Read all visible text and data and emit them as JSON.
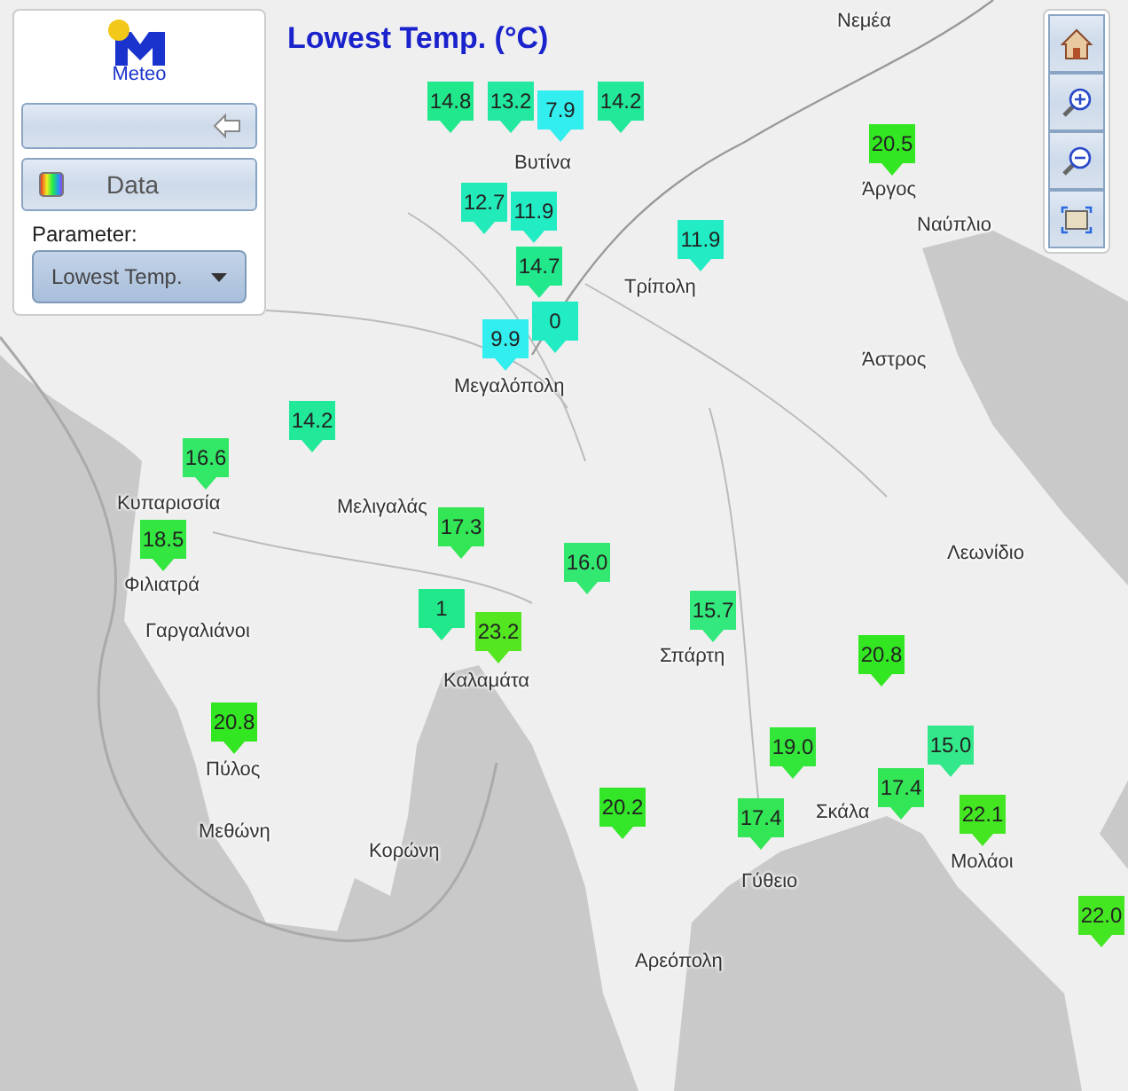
{
  "title": "Lowest Temp. (°C)",
  "panel": {
    "logo_text": "Meteo",
    "data_button": "Data",
    "parameter_label": "Parameter:",
    "parameter_select": "Lowest Temp."
  },
  "places": [
    "Νεμέα",
    "Βυτίνα",
    "Τρίπολη",
    "Άργος",
    "Ναύπλιο",
    "Μεγαλόπολη",
    "Άστρος",
    "Κυπαρισσία",
    "Μελιγαλάς",
    "Φιλιατρά",
    "Λεωνίδιο",
    "Γαργαλιάνοι",
    "Καλαμάτα",
    "Σπάρτη",
    "Πύλος",
    "Σκάλα",
    "Μολάοι",
    "Μεθώνη",
    "Κορώνη",
    "Γύθειο",
    "Αρεόπολη"
  ],
  "markers": [
    {
      "value": "14.8",
      "color": "#22e88c"
    },
    {
      "value": "13.2",
      "color": "#22e8a0"
    },
    {
      "value": "7.9",
      "color": "#33eeee"
    },
    {
      "value": "14.2",
      "color": "#22e89a"
    },
    {
      "value": "12.7",
      "color": "#22eab8"
    },
    {
      "value": "11.9",
      "color": "#22ecc4"
    },
    {
      "value": "14.7",
      "color": "#22e88c"
    },
    {
      "value": "0",
      "color": "#22ecc4"
    },
    {
      "value": "9.9",
      "color": "#33eeee"
    },
    {
      "value": "11.9",
      "color": "#22ecc4"
    },
    {
      "value": "20.5",
      "color": "#33e622"
    },
    {
      "value": "14.2",
      "color": "#22e89a"
    },
    {
      "value": "16.6",
      "color": "#33e866"
    },
    {
      "value": "18.5",
      "color": "#33e640"
    },
    {
      "value": "17.3",
      "color": "#33e655"
    },
    {
      "value": "16.0",
      "color": "#33e870"
    },
    {
      "value": "15.7",
      "color": "#33e87c"
    },
    {
      "value": "1",
      "color": "#22e88c"
    },
    {
      "value": "23.2",
      "color": "#55e622"
    },
    {
      "value": "20.8",
      "color": "#33e622"
    },
    {
      "value": "20.8",
      "color": "#33e622"
    },
    {
      "value": "19.0",
      "color": "#33e63a"
    },
    {
      "value": "15.0",
      "color": "#33e88a"
    },
    {
      "value": "17.4",
      "color": "#33e655"
    },
    {
      "value": "20.2",
      "color": "#33e628"
    },
    {
      "value": "17.4",
      "color": "#33e655"
    },
    {
      "value": "22.1",
      "color": "#44e622"
    },
    {
      "value": "22.0",
      "color": "#44e622"
    }
  ]
}
